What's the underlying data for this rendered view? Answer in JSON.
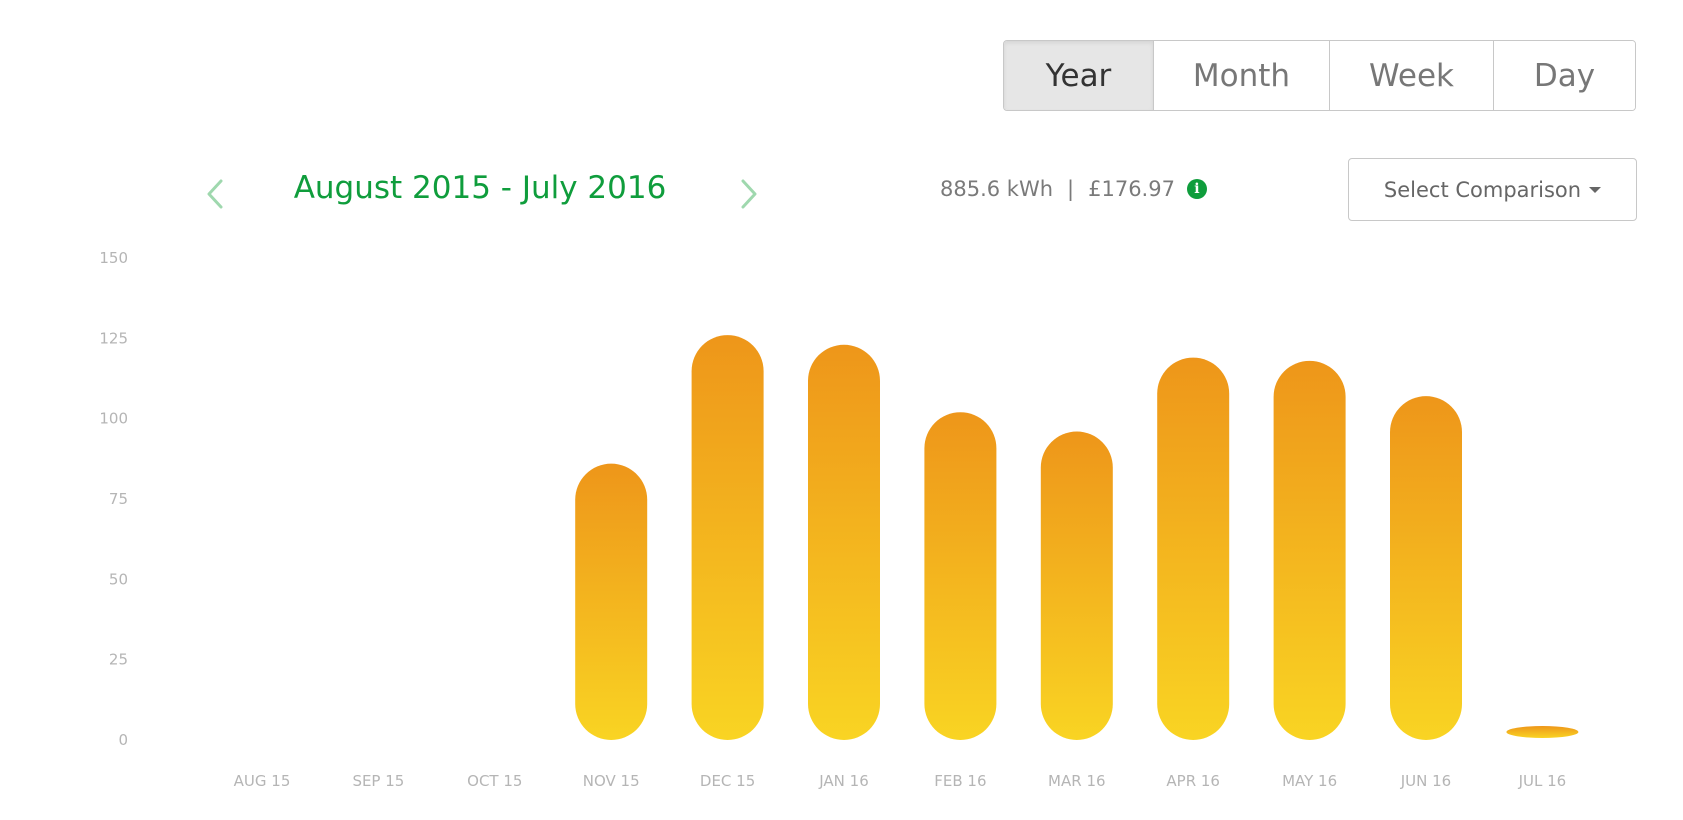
{
  "period_toggle": {
    "options": [
      "Year",
      "Month",
      "Week",
      "Day"
    ],
    "selected": "Year"
  },
  "navigation": {
    "date_range": "August 2015 - July 2016",
    "prev_icon": "chevron-left-icon",
    "next_icon": "chevron-right-icon"
  },
  "summary": {
    "energy": "885.6 kWh",
    "separator": "|",
    "cost": "£176.97",
    "info_icon": "info-icon"
  },
  "comparison": {
    "label": "Select Comparison"
  },
  "colors": {
    "accent_green": "#0f9d3c",
    "bar_top": "#ee961a",
    "bar_bottom": "#f9d423"
  },
  "chart_data": {
    "type": "bar",
    "categories": [
      "AUG 15",
      "SEP 15",
      "OCT 15",
      "NOV 15",
      "DEC 15",
      "JAN 16",
      "FEB 16",
      "MAR 16",
      "APR 16",
      "MAY 16",
      "JUN 16",
      "JUL 16"
    ],
    "values": [
      0,
      0,
      0,
      86,
      126,
      123,
      102,
      96,
      119,
      118,
      107,
      2
    ],
    "ylim": [
      0,
      150
    ],
    "yticks": [
      0,
      25,
      50,
      75,
      100,
      125,
      150
    ],
    "grid": false,
    "legend": "none"
  }
}
